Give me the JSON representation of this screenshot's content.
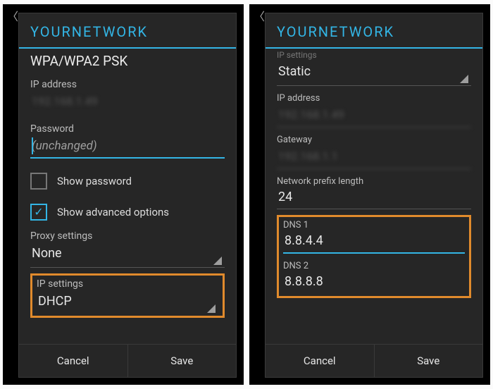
{
  "left": {
    "title": "YOURNETWORK",
    "security": "WPA/WPA2 PSK",
    "ip_address_label": "IP address",
    "ip_address_value": "192.168.1.49",
    "password_label": "Password",
    "password_placeholder": "(unchanged)",
    "show_password_label": "Show password",
    "show_password_checked": false,
    "show_advanced_label": "Show advanced options",
    "show_advanced_checked": true,
    "proxy_label": "Proxy settings",
    "proxy_value": "None",
    "ip_settings_label": "IP settings",
    "ip_settings_value": "DHCP",
    "cancel": "Cancel",
    "save": "Save"
  },
  "right": {
    "title": "YOURNETWORK",
    "cut_label": "IP settings",
    "ip_settings_value": "Static",
    "ip_address_label": "IP address",
    "ip_address_value": "192.168.1.49",
    "gateway_label": "Gateway",
    "gateway_value": "192.168.1.1",
    "prefix_label": "Network prefix length",
    "prefix_value": "24",
    "dns1_label": "DNS 1",
    "dns1_value": "8.8.4.4",
    "dns2_label": "DNS 2",
    "dns2_value": "8.8.8.8",
    "cancel": "Cancel",
    "save": "Save"
  }
}
